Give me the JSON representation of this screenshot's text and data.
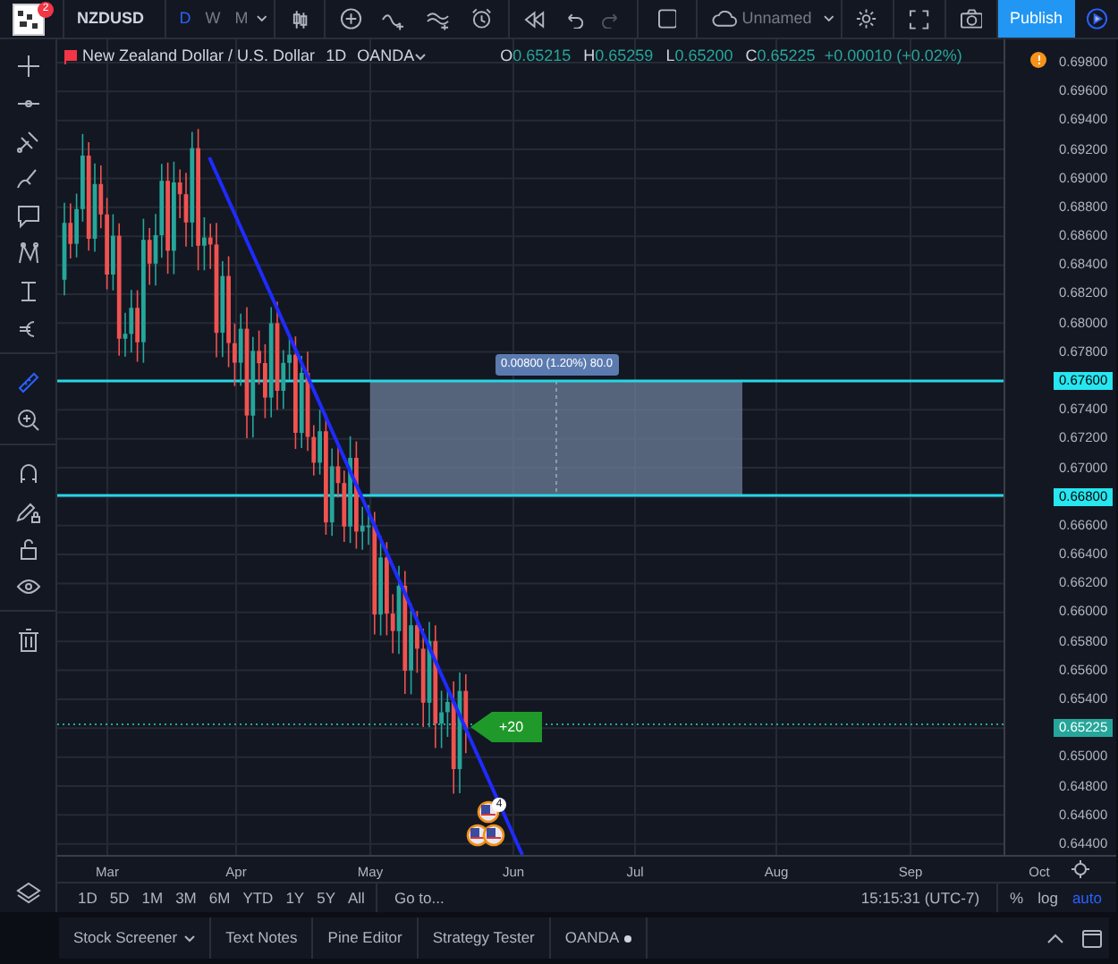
{
  "topbar": {
    "logo_badge": "2",
    "symbol": "NZDUSD",
    "intervals": [
      {
        "label": "D",
        "selected": true
      },
      {
        "label": "W",
        "selected": false
      },
      {
        "label": "M",
        "selected": false
      }
    ],
    "layout_name": "Unnamed",
    "publish": "Publish"
  },
  "tools": [
    {
      "selected": false
    },
    {
      "selected": false
    },
    {
      "selected": false
    },
    {
      "selected": false
    },
    {
      "selected": false
    },
    {
      "selected": false
    },
    {
      "selected": false
    },
    {
      "selected": false
    },
    {
      "selected": true
    },
    {
      "selected": false
    },
    {
      "selected": false
    },
    {
      "selected": false
    },
    {
      "selected": false
    },
    {
      "selected": false
    },
    {
      "selected": false
    }
  ],
  "legend": {
    "title": "New Zealand Dollar / U.S. Dollar",
    "interval": "1D",
    "source": "OANDA",
    "ohlc": [
      {
        "key": "O",
        "value": "0.65215"
      },
      {
        "key": "H",
        "value": "0.65259"
      },
      {
        "key": "L",
        "value": "0.65200"
      },
      {
        "key": "C",
        "value": "0.65225"
      }
    ],
    "change": "+0.00010 (+0.02%)"
  },
  "chart": {
    "range_label": "0.00800 (1.20%) 80.0",
    "callout": "+20",
    "event_count": "4",
    "price_axis": [
      {
        "label": "0.69800",
        "kind": "tick"
      },
      {
        "label": "0.69600",
        "kind": "tick"
      },
      {
        "label": "0.69400",
        "kind": "tick"
      },
      {
        "label": "0.69200",
        "kind": "tick"
      },
      {
        "label": "0.69000",
        "kind": "tick"
      },
      {
        "label": "0.68800",
        "kind": "tick"
      },
      {
        "label": "0.68600",
        "kind": "tick"
      },
      {
        "label": "0.68400",
        "kind": "tick"
      },
      {
        "label": "0.68200",
        "kind": "tick"
      },
      {
        "label": "0.68000",
        "kind": "tick"
      },
      {
        "label": "0.67800",
        "kind": "tick"
      },
      {
        "label": "0.67600",
        "kind": "line"
      },
      {
        "label": "0.67400",
        "kind": "tick"
      },
      {
        "label": "0.67200",
        "kind": "tick"
      },
      {
        "label": "0.67000",
        "kind": "tick"
      },
      {
        "label": "0.66800",
        "kind": "line"
      },
      {
        "label": "0.66600",
        "kind": "tick"
      },
      {
        "label": "0.66400",
        "kind": "tick"
      },
      {
        "label": "0.66200",
        "kind": "tick"
      },
      {
        "label": "0.66000",
        "kind": "tick"
      },
      {
        "label": "0.65800",
        "kind": "tick"
      },
      {
        "label": "0.65600",
        "kind": "tick"
      },
      {
        "label": "0.65400",
        "kind": "tick"
      },
      {
        "label": "0.65225",
        "kind": "price"
      },
      {
        "label": "0.65000",
        "kind": "tick"
      },
      {
        "label": "0.64800",
        "kind": "tick"
      },
      {
        "label": "0.64600",
        "kind": "tick"
      },
      {
        "label": "0.64400",
        "kind": "tick"
      }
    ],
    "date_axis": [
      "Mar",
      "Apr",
      "May",
      "Jun",
      "Jul",
      "Aug",
      "Sep",
      "Oct"
    ]
  },
  "range_bar": {
    "ranges": [
      "1D",
      "5D",
      "1M",
      "3M",
      "6M",
      "YTD",
      "1Y",
      "5Y",
      "All"
    ],
    "goto": "Go to...",
    "clock": "15:15:31 (UTC-7)",
    "scale": [
      {
        "label": "%",
        "selected": false
      },
      {
        "label": "log",
        "selected": false
      },
      {
        "label": "auto",
        "selected": true
      }
    ]
  },
  "bottom_tabs": [
    {
      "label": "Stock Screener",
      "kind": "dropdown"
    },
    {
      "label": "Text Notes",
      "kind": "plain"
    },
    {
      "label": "Pine Editor",
      "kind": "plain"
    },
    {
      "label": "Strategy Tester",
      "kind": "plain"
    },
    {
      "label": "OANDA",
      "kind": "dot"
    }
  ]
}
